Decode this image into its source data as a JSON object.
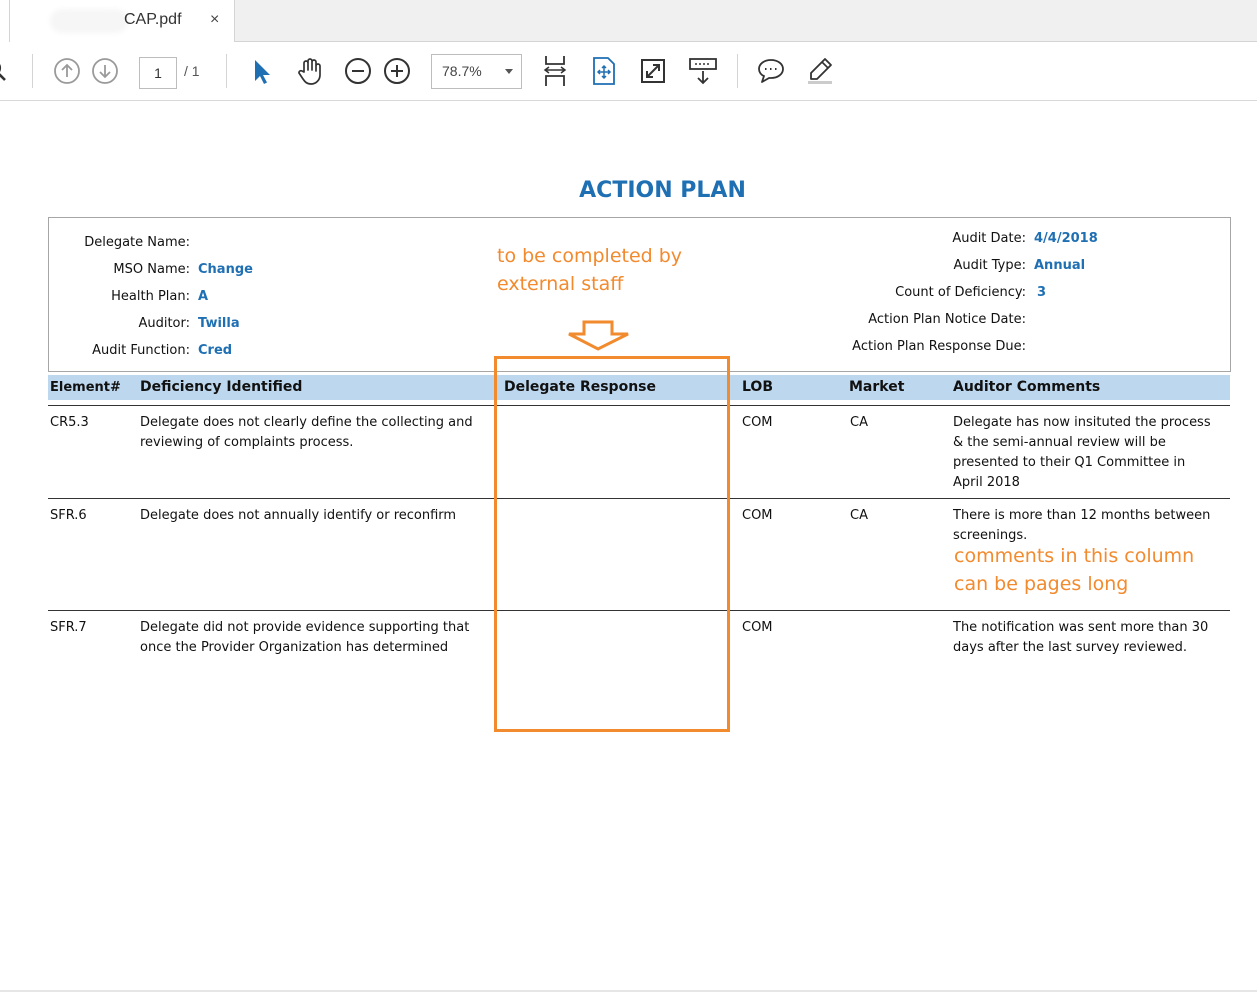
{
  "tab": {
    "title": "CAP.pdf",
    "close": "×"
  },
  "toolbar": {
    "page_current": "1",
    "page_total": "/ 1",
    "zoom": "78.7%"
  },
  "document": {
    "title": "ACTION PLAN",
    "left_fields": [
      {
        "label": "Delegate Name:",
        "value": ""
      },
      {
        "label": "MSO Name:",
        "value": "Change"
      },
      {
        "label": "Health Plan:",
        "value": "A"
      },
      {
        "label": "Auditor:",
        "value": "Twilla"
      },
      {
        "label": "Audit Function:",
        "value": "Cred"
      }
    ],
    "right_fields": [
      {
        "label": "Audit Date:",
        "value": "4/4/2018"
      },
      {
        "label": "Audit Type:",
        "value": "Annual"
      },
      {
        "label": "Count of Deficiency:",
        "value": "3"
      },
      {
        "label": "Action Plan Notice Date:",
        "value": ""
      },
      {
        "label": "Action Plan Response Due:",
        "value": ""
      }
    ],
    "columns": [
      "Element#",
      "Deficiency Identified",
      "Delegate Response",
      "LOB",
      "Market",
      "Auditor Comments"
    ],
    "rows": [
      {
        "element": "CR5.3",
        "deficiency": [
          "Delegate does not clearly define the collecting and",
          "reviewing of complaints process."
        ],
        "response": "",
        "lob": "COM",
        "market": "CA",
        "comments": [
          "Delegate has now  insituted the process",
          "& the semi-annual review will be",
          "presented to their Q1 Committee in",
          "April 2018"
        ]
      },
      {
        "element": "SFR.6",
        "deficiency": [
          "Delegate does not annually identify or reconfirm"
        ],
        "response": "",
        "lob": "COM",
        "market": "CA",
        "comments": [
          "There is more than 12 months between",
          "screenings."
        ]
      },
      {
        "element": "SFR.7",
        "deficiency": [
          "Delegate did not provide evidence supporting that",
          "once the Provider Organization has determined"
        ],
        "response": "",
        "lob": "COM",
        "market": "",
        "comments": [
          "The notification was sent more than 30",
          "days after the last survey reviewed."
        ]
      }
    ]
  },
  "annotations": {
    "top": [
      "to be completed by",
      "external staff"
    ],
    "comments": [
      "comments in this column",
      "can be pages long"
    ],
    "color": "#f28a2e"
  },
  "colors": {
    "accent": "#1f6fb3",
    "header_bg": "#bdd7ee",
    "annotation": "#f28a2e"
  }
}
